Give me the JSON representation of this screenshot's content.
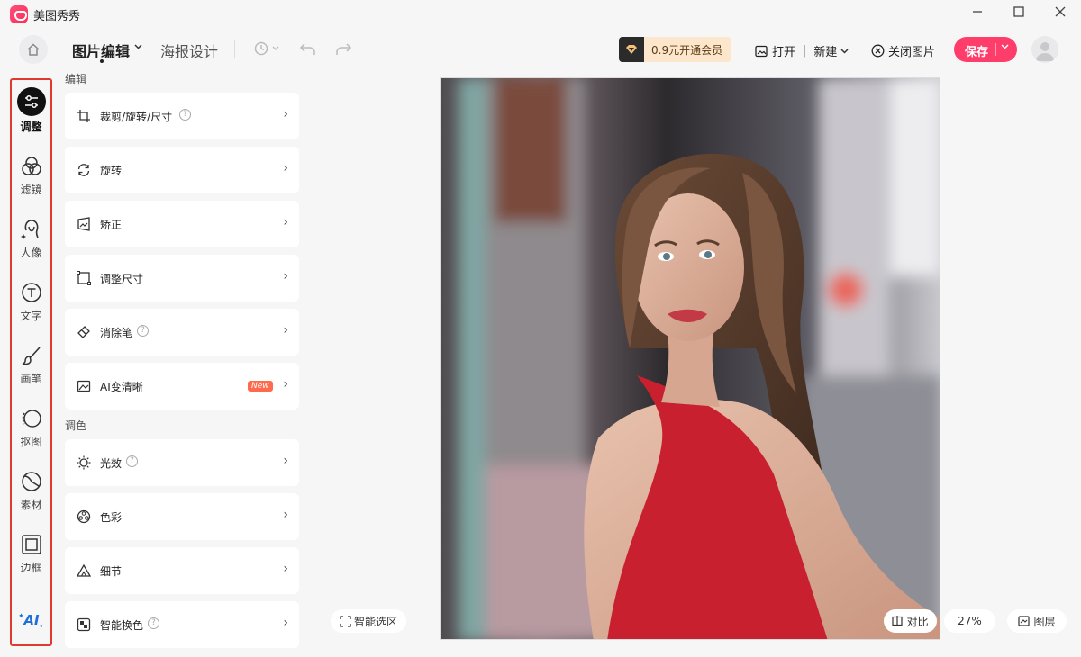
{
  "app": {
    "title": "美图秀秀"
  },
  "window": {
    "minimize": "—",
    "maximize": "☐",
    "close": "✕"
  },
  "toolbar": {
    "tab_edit": "图片编辑",
    "tab_poster": "海报设计",
    "vip_label": "0.9元开通会员",
    "open_label": "打开",
    "new_label": "新建",
    "close_image_label": "关闭图片",
    "save_label": "保存"
  },
  "rail": {
    "items": [
      {
        "label": "调整",
        "icon": "adjust-icon"
      },
      {
        "label": "滤镜",
        "icon": "filter-icon"
      },
      {
        "label": "人像",
        "icon": "portrait-icon"
      },
      {
        "label": "文字",
        "icon": "text-icon"
      },
      {
        "label": "画笔",
        "icon": "brush-icon"
      },
      {
        "label": "抠图",
        "icon": "cutout-icon"
      },
      {
        "label": "素材",
        "icon": "sticker-icon"
      },
      {
        "label": "边框",
        "icon": "frame-icon"
      }
    ],
    "ai_label": "AI"
  },
  "panel": {
    "section_edit": "编辑",
    "section_color": "调色",
    "edit_items": [
      {
        "label": "裁剪/旋转/尺寸",
        "help": "?",
        "icon": "crop-icon"
      },
      {
        "label": "旋转",
        "icon": "rotate-icon"
      },
      {
        "label": "矫正",
        "icon": "correct-icon"
      },
      {
        "label": "调整尺寸",
        "icon": "resize-icon"
      },
      {
        "label": "消除笔",
        "help": "?",
        "icon": "eraser-icon"
      },
      {
        "label": "AI变清晰",
        "badge": "New",
        "icon": "ai-enhance-icon"
      }
    ],
    "color_items": [
      {
        "label": "光效",
        "help": "?",
        "icon": "light-icon"
      },
      {
        "label": "色彩",
        "icon": "color-icon"
      },
      {
        "label": "细节",
        "icon": "detail-icon"
      },
      {
        "label": "智能换色",
        "help": "?",
        "icon": "smart-recolor-icon"
      }
    ],
    "arrow": "›"
  },
  "canvas": {
    "smart_select_label": "智能选区",
    "compare_label": "对比",
    "zoom": "27%",
    "layers_label": "图层"
  },
  "colors": {
    "accent": "#ff3d6b",
    "highlight_border": "#e03a2f",
    "dress": "#c8202e"
  }
}
